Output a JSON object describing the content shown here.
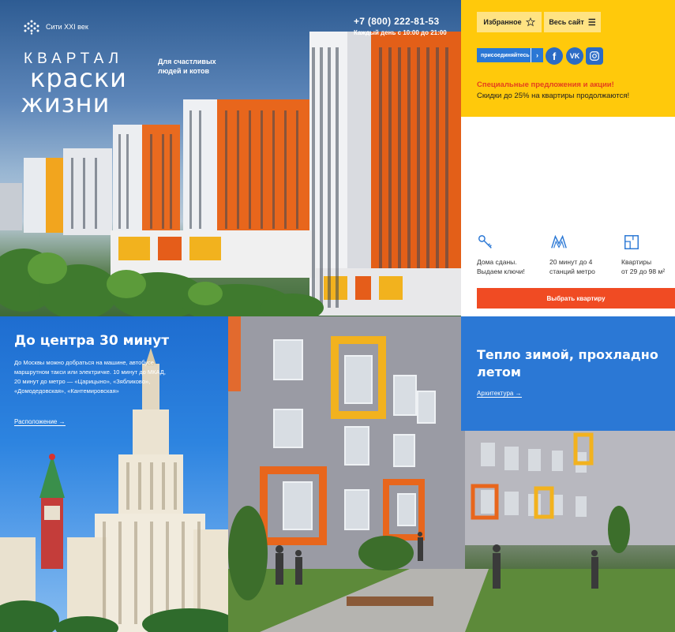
{
  "header": {
    "logo_text": "Сити XXI век",
    "phone": "+7 (800) 222-81-53",
    "hours": "Каждый день с 10:00 до 21:00"
  },
  "hero": {
    "kvartal": "КВАРТАЛ",
    "title_line1": "краски",
    "title_line2": "жизни",
    "tagline": "Для счастливых людей и котов"
  },
  "topbar": {
    "favorites_label": "Избранное",
    "site_label": "Весь сайт",
    "join_label": "присоединяйтесь",
    "social": [
      "f",
      "VK",
      "ig"
    ],
    "promo_title": "Специальные предложения и акции!",
    "promo_text": "Скидки до 25% на квартиры продолжаются!"
  },
  "features": {
    "items": [
      {
        "icon": "key-icon",
        "line1": "Дома сданы.",
        "line2": "Выдаем ключи!"
      },
      {
        "icon": "metro-icon",
        "line1": "20 минут до 4",
        "line2": "станций метро"
      },
      {
        "icon": "apartment-plan-icon",
        "line1": "Квартиры",
        "line2": "от 29 до 98 м²"
      }
    ],
    "choose_label": "Выбрать квартиру"
  },
  "moscow": {
    "title": "До центра 30 минут",
    "text": "До Москвы можно добраться на машине, автобусе, маршрутном такси или электричке. 10 минут до МКАД, 20 минут до метро — «Царицыно», «Зябликово», «Домодедовская», «Кантемировская»",
    "link": "Расположение →"
  },
  "architecture": {
    "title": "Тепло зимой, прохладно летом",
    "link": "Архитектура →"
  },
  "colors": {
    "yellow": "#ffc90b",
    "blue": "#2b78d5",
    "orange_red": "#f04b23"
  }
}
